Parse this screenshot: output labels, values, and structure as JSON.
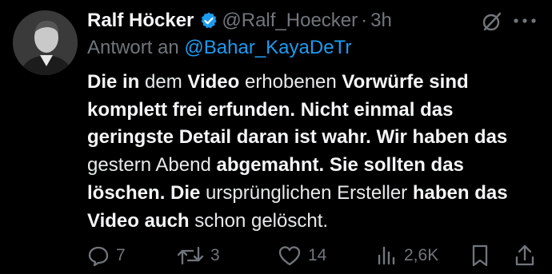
{
  "tweet": {
    "author_name": "Ralf Höcker",
    "handle": "@Ralf_Hoecker",
    "separator": "·",
    "time": "3h",
    "reply_prefix": "Antwort an",
    "reply_mention": "@Bahar_KayaDeTr",
    "body_segments": [
      {
        "text": "Die in",
        "bold": true
      },
      {
        "text": " dem ",
        "bold": false
      },
      {
        "text": "Video",
        "bold": true
      },
      {
        "text": " erhobenen ",
        "bold": false
      },
      {
        "text": "Vorwürfe sind komplett frei erfunden. Nicht einmal das geringste Detail daran ist wahr. Wir haben das",
        "bold": true
      },
      {
        "text": " gestern ",
        "bold": false
      },
      {
        "text": "Abend",
        "bold": false
      },
      {
        "text": " abgemahnt. Sie sollten das löschen.",
        "bold": true
      },
      {
        "text": " ",
        "bold": false
      },
      {
        "text": "Die",
        "bold": true
      },
      {
        "text": " ursprünglichen Ersteller ",
        "bold": false
      },
      {
        "text": "haben das Video auch",
        "bold": true
      },
      {
        "text": " schon gelöscht.",
        "bold": false
      }
    ]
  },
  "actions": {
    "replies": "7",
    "reposts": "3",
    "likes": "14",
    "views": "2,6K"
  },
  "icons": {
    "verified": "verified-badge-icon",
    "grok": "grok-icon",
    "more": "more-options-icon",
    "reply": "reply-icon",
    "repost": "repost-icon",
    "like": "like-icon",
    "views": "views-icon",
    "bookmark": "bookmark-icon",
    "share": "share-icon"
  },
  "colors": {
    "background": "#000000",
    "text": "#e7e9ea",
    "muted": "#71767b",
    "link": "#1d9bf0",
    "verified": "#1d9bf0"
  }
}
